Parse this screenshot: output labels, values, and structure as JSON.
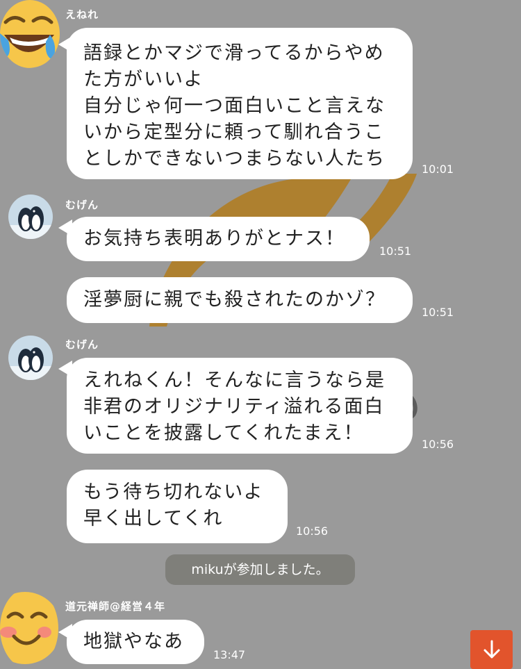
{
  "colors": {
    "background": "#9a9a9a",
    "bubble": "#ffffff",
    "system_pill": "#7f7f7a",
    "scroll_button": "#e2542c",
    "watermark": "#b07d24"
  },
  "messages": [
    {
      "sender": "えねれ",
      "avatar_icon": "face-with-tears-of-joy-icon",
      "text": "語録とかマジで滑ってるからやめ\nた方がいいよ\n自分じゃ何一つ面白いこと言えな\nいから定型分に頼って馴れ合うこ\nとしかできないつまらない人たち",
      "time": "10:01"
    },
    {
      "sender": "むげん",
      "avatar_icon": "penguins-avatar-icon",
      "text": "お気持ち表明ありがとナス！",
      "time": "10:51"
    },
    {
      "text": "淫夢厨に親でも殺されたのかゾ？",
      "time": "10:51"
    },
    {
      "sender": "むげん",
      "avatar_icon": "penguins-avatar-icon",
      "text": "えれねくん！そんなに言うなら是\n非君のオリジナリティ溢れる面白\nいことを披露してくれたまえ！",
      "time": "10:56"
    },
    {
      "text": "もう待ち切れないよ\n早く出してくれ",
      "time": "10:56"
    },
    {
      "sender": "道元禅師@経営４年",
      "avatar_icon": "smiling-face-icon",
      "text": "地獄やなあ",
      "time": "13:47"
    }
  ],
  "system_message": "mikuが参加しました。",
  "scroll_button_icon": "arrow-down-icon"
}
